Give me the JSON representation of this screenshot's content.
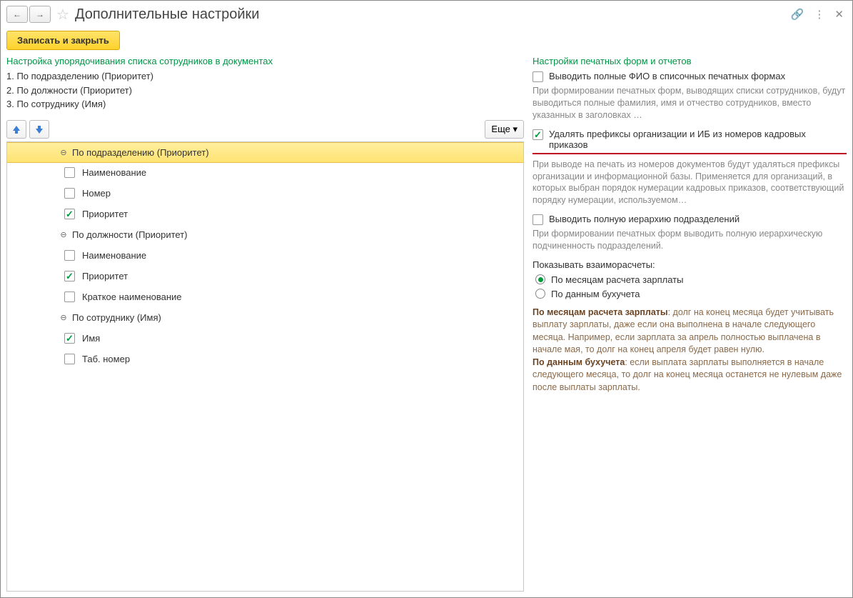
{
  "titlebar": {
    "title": "Дополнительные настройки"
  },
  "toolbar": {
    "save_label": "Записать и закрыть"
  },
  "left": {
    "section_title": "Настройка упорядочивания списка сотрудников в документах",
    "order": [
      "1. По подразделению (Приоритет)",
      "2. По должности (Приоритет)",
      "3. По сотруднику (Имя)"
    ],
    "more_label": "Еще",
    "tree": {
      "g1": "По подразделению (Приоритет)",
      "g1_i1": "Наименование",
      "g1_i2": "Номер",
      "g1_i3": "Приоритет",
      "g2": "По должности (Приоритет)",
      "g2_i1": "Наименование",
      "g2_i2": "Приоритет",
      "g2_i3": "Краткое наименование",
      "g3": "По сотруднику (Имя)",
      "g3_i1": "Имя",
      "g3_i2": "Таб. номер"
    }
  },
  "right": {
    "section_title": "Настройки печатных форм и отчетов",
    "chk1_label": "Выводить полные ФИО в списочных печатных формах",
    "chk1_desc": "При формировании печатных форм, выводящих списки сотрудников, будут выводиться полные фамилия, имя и отчество сотрудников, вместо указанных в заголовках …",
    "chk2_label": "Удалять префиксы организации и ИБ из номеров кадровых приказов",
    "chk2_desc": "При выводе на печать из номеров документов будут удаляться префиксы организации и информационной базы. Применяется для организаций, в которых выбран порядок нумерации кадровых приказов, соответствующий порядку нумерации, используемом…",
    "chk3_label": "Выводить полную иерархию подразделений",
    "chk3_desc": "При формировании печатных форм выводить полную иерархическую подчиненность подразделений.",
    "radio_title": "Показывать взаиморасчеты:",
    "radio1": "По месяцам расчета зарплаты",
    "radio2": "По данным бухучета",
    "expl1_bold": "По месяцам расчета зарплаты",
    "expl1_rest": ": долг на конец месяца будет учитывать выплату зарплаты, даже если она выполнена в начале следующего месяца. Например, если зарплата за апрель полностью выплачена в начале мая, то долг на конец апреля будет равен нулю.",
    "expl2_bold": "По данным бухучета",
    "expl2_rest": ": если выплата зарплаты выполняется в начале следующего месяца, то долг на конец месяца останется не нулевым даже после выплаты зарплаты."
  }
}
